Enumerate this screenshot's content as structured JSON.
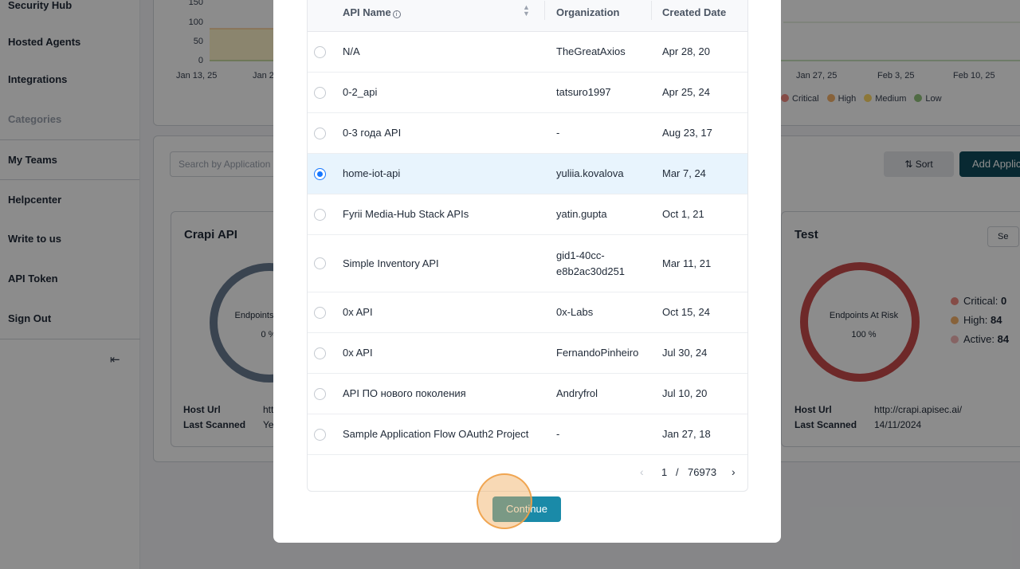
{
  "sidebar": {
    "items": [
      {
        "label": "Security Hub"
      },
      {
        "label": "Hosted Agents"
      },
      {
        "label": "Integrations"
      },
      {
        "label": "Categories"
      },
      {
        "label": "My Teams"
      },
      {
        "label": "Helpcenter"
      },
      {
        "label": "Write to us"
      },
      {
        "label": "API Token"
      },
      {
        "label": "Sign Out"
      }
    ]
  },
  "chart": {
    "y_ticks": [
      "150",
      "100",
      "50",
      "0"
    ],
    "x_ticks": [
      "Jan 13, 25",
      "Jan 2",
      "Jan 27, 25",
      "Feb 3, 25",
      "Feb 10, 25"
    ],
    "legend": [
      {
        "label": "Critical",
        "color": "#f28b82"
      },
      {
        "label": "High",
        "color": "#f6b26b"
      },
      {
        "label": "Medium",
        "color": "#ffd966"
      },
      {
        "label": "Low",
        "color": "#93c47d"
      }
    ]
  },
  "toolbar": {
    "search_placeholder": "Search by Application",
    "sort_label": "Sort",
    "add_label": "Add Applic"
  },
  "cards": {
    "left": {
      "title": "Crapi API",
      "ring_label": "Endpoints",
      "ring_value": "0 %",
      "host_url_label": "Host Url",
      "host_url": "htt",
      "last_scanned_label": "Last Scanned",
      "last_scanned": "Ye"
    },
    "right": {
      "title": "Test",
      "select_label": "Se",
      "ring_label": "Endpoints At Risk",
      "ring_value": "100 %",
      "critical_label": "Critical:",
      "critical_value": "0",
      "high_label": "High:",
      "high_value": "84",
      "active_label": "Active:",
      "active_value": "84",
      "host_url_label": "Host Url",
      "host_url": "http://crapi.apisec.ai/",
      "last_scanned_label": "Last Scanned",
      "last_scanned": "14/11/2024"
    }
  },
  "modal": {
    "columns": {
      "api_name": "API Name",
      "organization": "Organization",
      "created_date": "Created Date"
    },
    "rows": [
      {
        "name": "N/A",
        "org": "TheGreatAxios",
        "date": "Apr 28, 20",
        "selected": false
      },
      {
        "name": "0-2_api",
        "org": "tatsuro1997",
        "date": "Apr 25, 24",
        "selected": false
      },
      {
        "name": "0-3 года API",
        "org": "-",
        "date": "Aug 23, 17",
        "selected": false
      },
      {
        "name": "home-iot-api",
        "org": "yuliia.kovalova",
        "date": "Mar 7, 24",
        "selected": true
      },
      {
        "name": "Fyrii Media-Hub Stack APIs",
        "org": "yatin.gupta",
        "date": "Oct 1, 21",
        "selected": false
      },
      {
        "name": "Simple Inventory API",
        "org": "gid1-40cc-",
        "org2": "e8b2ac30d251",
        "date": "Mar 11, 21",
        "selected": false
      },
      {
        "name": "0x API",
        "org": "0x-Labs",
        "date": "Oct 15, 24",
        "selected": false
      },
      {
        "name": "0x API",
        "org": "FernandoPinheiro",
        "date": "Jul 30, 24",
        "selected": false
      },
      {
        "name": "API ПО нового поколения",
        "org": "Andryfrol",
        "date": "Jul 10, 20",
        "selected": false
      },
      {
        "name": "Sample Application Flow OAuth2 Project",
        "org": "-",
        "date": "Jan 27, 18",
        "selected": false
      }
    ],
    "pagination": {
      "current": "1",
      "separator": "/",
      "total": "76973"
    },
    "continue_label": "Continue"
  }
}
